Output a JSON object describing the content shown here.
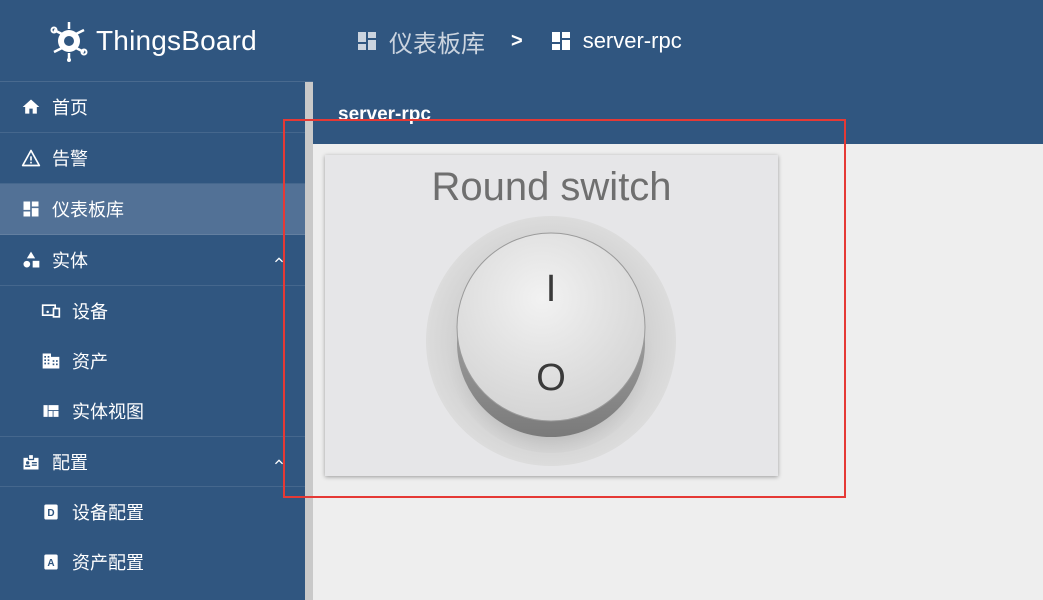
{
  "app": {
    "brand": "ThingsBoard"
  },
  "sidebar": {
    "items": [
      {
        "label": "首页",
        "icon": "home-icon"
      },
      {
        "label": "告警",
        "icon": "warning-icon"
      },
      {
        "label": "仪表板库",
        "icon": "dashboard-icon",
        "active": true
      },
      {
        "label": "实体",
        "icon": "shapes-icon",
        "expanded": true
      },
      {
        "label": "设备",
        "icon": "devices-icon"
      },
      {
        "label": "资产",
        "icon": "domain-icon"
      },
      {
        "label": "实体视图",
        "icon": "view-quilt-icon"
      },
      {
        "label": "配置",
        "icon": "badge-icon",
        "expanded": true
      },
      {
        "label": "设备配置",
        "icon": "device-profile-icon"
      },
      {
        "label": "资产配置",
        "icon": "asset-profile-icon"
      }
    ]
  },
  "breadcrumb": {
    "root": "仪表板库",
    "separator": ">",
    "current": "server-rpc"
  },
  "dashboard": {
    "title": "server-rpc"
  },
  "widget": {
    "title": "Round switch",
    "on_label": "I",
    "off_label": "O",
    "state": "off"
  },
  "colors": {
    "primary": "#305680",
    "active_item": "#527196",
    "highlight": "#e53935",
    "background": "#eeeeee"
  }
}
